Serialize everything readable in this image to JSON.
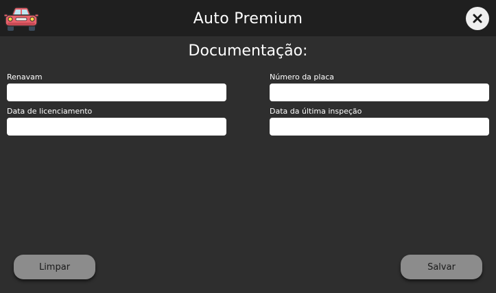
{
  "app": {
    "title": "Auto Premium",
    "logo_icon": "car-icon",
    "close_icon": "close-icon"
  },
  "section": {
    "title": "Documentação:"
  },
  "fields": {
    "renavam": {
      "label": "Renavam",
      "value": "",
      "placeholder": ""
    },
    "plate_number": {
      "label": "Número da placa",
      "value": "",
      "placeholder": ""
    },
    "license_date": {
      "label": "Data de licenciamento",
      "value": "",
      "placeholder": ""
    },
    "last_inspection_date": {
      "label": "Data da última inspeção",
      "value": "",
      "placeholder": ""
    }
  },
  "actions": {
    "clear_label": "Limpar",
    "save_label": "Salvar"
  },
  "colors": {
    "background": "#2e2e2e",
    "titlebar": "#1f1f1f",
    "button": "#8c8c8c",
    "input": "#ffffff",
    "car_body": "#e8626c"
  }
}
